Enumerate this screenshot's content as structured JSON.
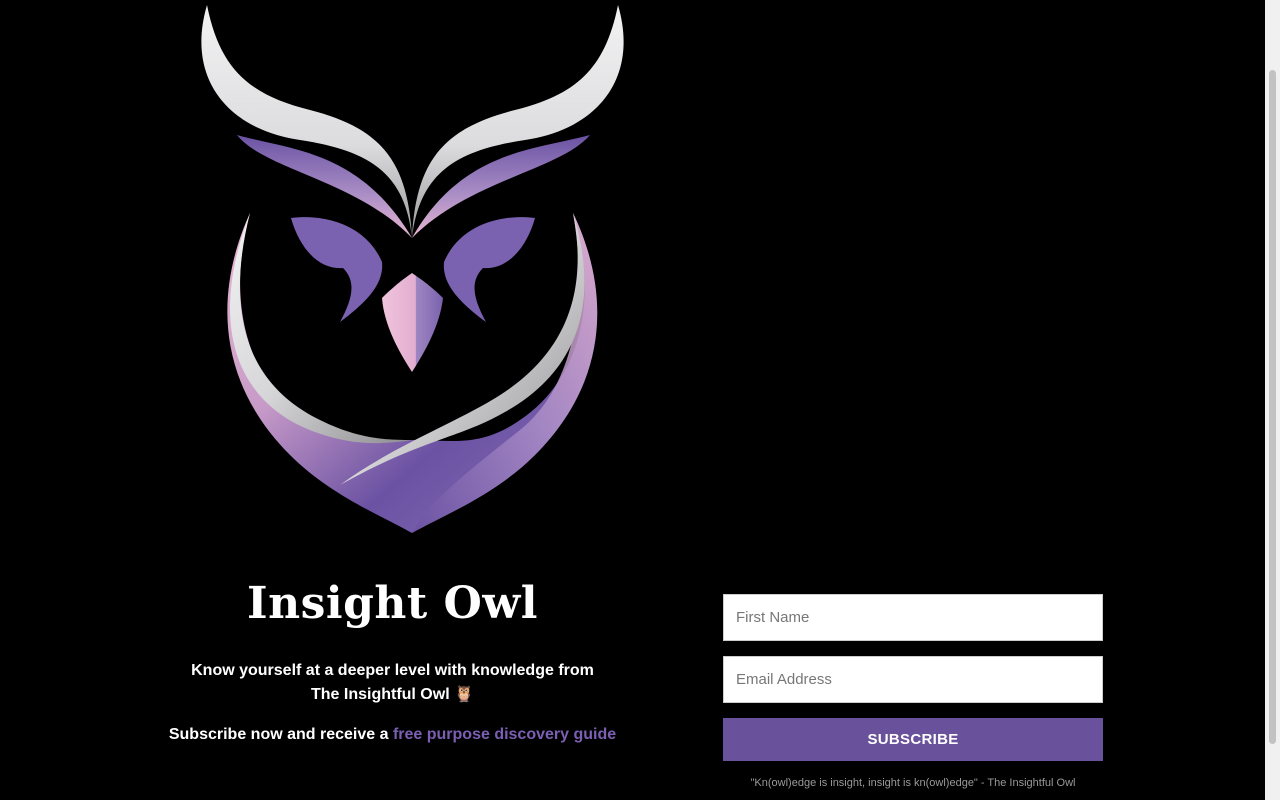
{
  "brand": {
    "title": "Insight Owl",
    "logo_icon": "owl-logo-icon"
  },
  "hero": {
    "tagline": "Know yourself at a deeper level with knowledge from The Insightful Owl",
    "tagline_emoji": "🦉",
    "offer_prefix": "Subscribe now and receive a",
    "offer_link": "free purpose discovery guide"
  },
  "form": {
    "first_name_placeholder": "First Name",
    "email_placeholder": "Email Address",
    "subscribe_label": "SUBSCRIBE",
    "quote": "\"Kn(owl)edge is insight, insight is kn(owl)edge\" - The Insightful Owl"
  },
  "colors": {
    "accent": "#6a519b",
    "link": "#7b5fb3",
    "background": "#000000",
    "logo_lavender": "#e9b7d3",
    "logo_purple": "#6b52a3",
    "logo_silver": "#e6e7e8"
  }
}
